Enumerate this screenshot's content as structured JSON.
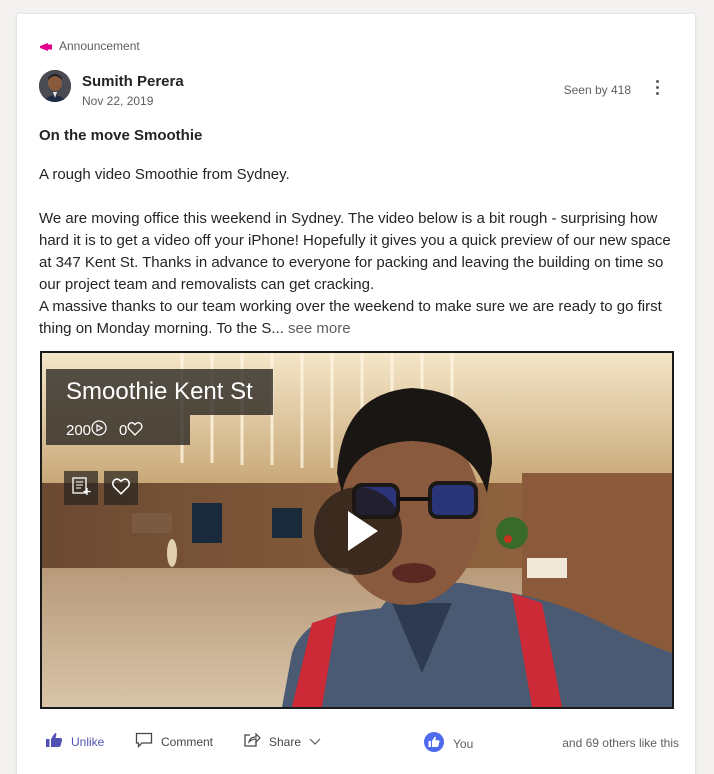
{
  "announcement": {
    "label": "Announcement",
    "icon": "megaphone-icon",
    "color": "#e3008c"
  },
  "post": {
    "author": "Sumith Perera",
    "date": "Nov 22, 2019",
    "seen": "Seen by 418",
    "title": "On the move Smoothie",
    "body": [
      "A rough video Smoothie from Sydney.",
      "",
      "We are moving office this weekend in Sydney. The video below is a bit rough - surprising how hard it is to get a video off your iPhone! Hopefully it gives you a quick preview of our new space at 347 Kent St. Thanks in advance to everyone for packing and leaving the building on time so our project team and removalists can get cracking.",
      "A massive thanks to our team working over the weekend to make sure we are ready to go first thing on Monday morning. To the S..."
    ],
    "see_more": "see more"
  },
  "video": {
    "title": "Smoothie Kent St",
    "views": "200",
    "likes": "0"
  },
  "actions": {
    "unlike": "Unlike",
    "comment": "Comment",
    "share": "Share",
    "you": "You",
    "others": "and 69 others like this"
  },
  "colors": {
    "accent": "#4f52b2",
    "like_badge": "#4f6bed"
  }
}
